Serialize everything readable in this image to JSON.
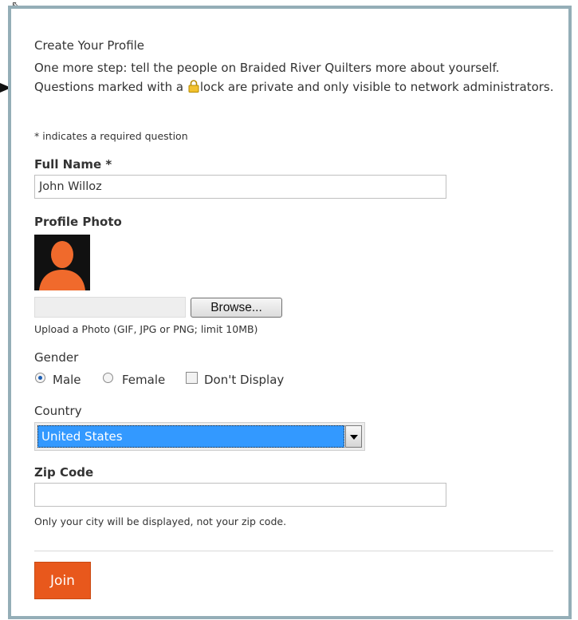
{
  "form": {
    "heading": "Create Your Profile",
    "intro_before_lock": "One more step: tell the people on Braided River Quilters more about yourself. Questions marked with a",
    "intro_after_lock": "lock are private and only visible to network administrators.",
    "required_note": "* indicates a required question"
  },
  "full_name": {
    "label": "Full Name *",
    "value": "John Willoz"
  },
  "profile_photo": {
    "label": "Profile Photo",
    "browse_label": "Browse...",
    "hint": "Upload a Photo (GIF, JPG or PNG; limit 10MB)"
  },
  "gender": {
    "label": "Gender",
    "options": [
      {
        "label": "Male",
        "selected": true
      },
      {
        "label": "Female",
        "selected": false
      }
    ],
    "dont_display_label": "Don't Display"
  },
  "country": {
    "label": "Country",
    "value": "United States"
  },
  "zip_code": {
    "label": "Zip Code",
    "value": "",
    "hint": "Only your city will be displayed, not your zip code."
  },
  "actions": {
    "join_label": "Join"
  },
  "colors": {
    "frame_border": "#94aeb7",
    "join_button": "#e8581c",
    "avatar_silhouette": "#f06a2c",
    "select_highlight": "#3399ff"
  },
  "icons": [
    "lock-icon",
    "avatar-placeholder-icon",
    "chevron-down-icon",
    "cursor-icon",
    "arrow-pointer-icon"
  ]
}
